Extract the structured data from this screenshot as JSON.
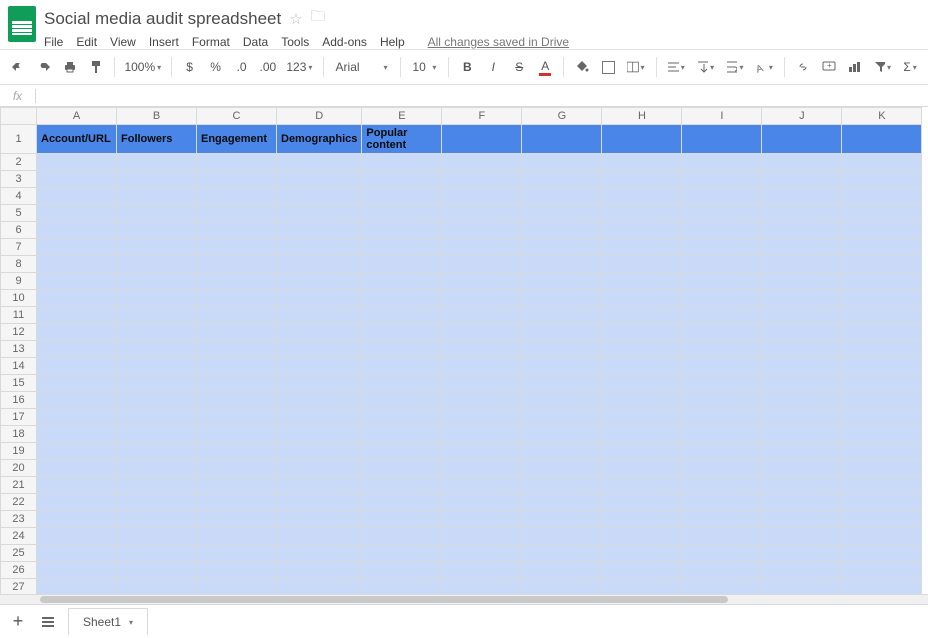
{
  "title": "Social media audit spreadsheet",
  "menus": [
    "File",
    "Edit",
    "View",
    "Insert",
    "Format",
    "Data",
    "Tools",
    "Add-ons",
    "Help"
  ],
  "save_status": "All changes saved in Drive",
  "toolbar": {
    "zoom": "100%",
    "currency": "$",
    "percent": "%",
    "dec_dec": ".0",
    "inc_dec": ".00",
    "more_fmt": "123",
    "font": "Arial",
    "size": "10"
  },
  "columns": [
    "A",
    "B",
    "C",
    "D",
    "E",
    "F",
    "G",
    "H",
    "I",
    "J",
    "K"
  ],
  "rows": 28,
  "headers": [
    "Account/URL",
    "Followers",
    "Engagement",
    "Demographics",
    "Popular content"
  ],
  "sheet_tab": "Sheet1",
  "fx_label": "fx"
}
